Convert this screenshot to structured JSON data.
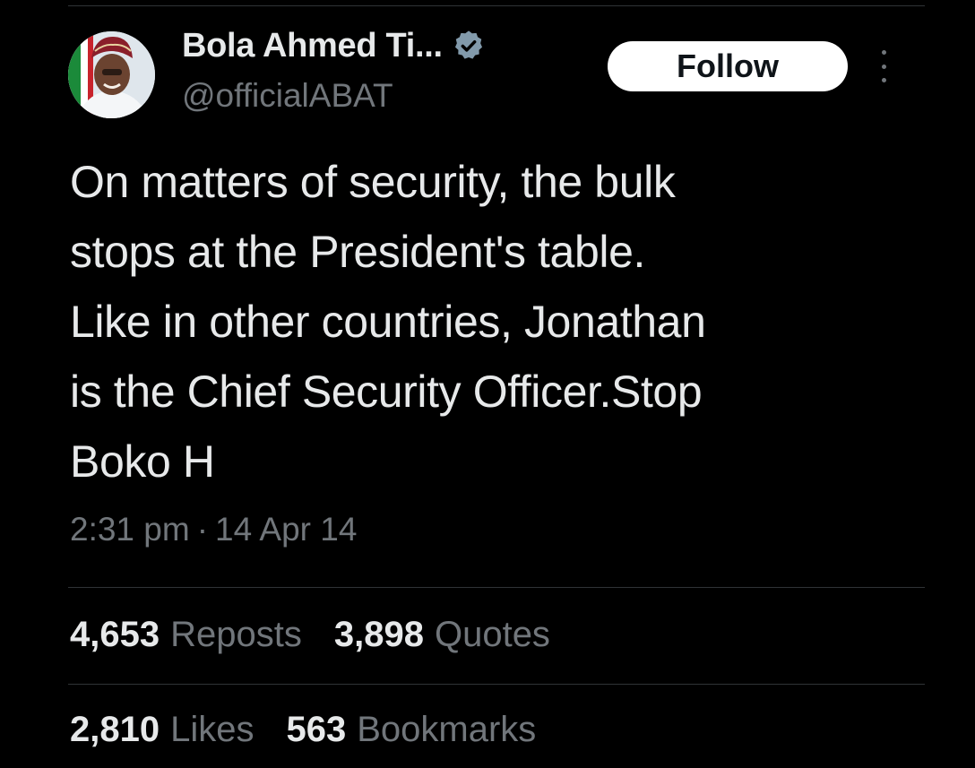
{
  "author": {
    "display_name": "Bola Ahmed Ti...",
    "handle": "@officialABAT",
    "verified_icon": "verified-badge-icon",
    "avatar": "avatar"
  },
  "actions": {
    "follow_label": "Follow",
    "more_icon": "more-vertical-icon"
  },
  "tweet": {
    "lines": [
      "On matters of security, the bulk",
      "stops at the President's table.",
      "Like in other countries, Jonathan",
      "is the Chief Security Officer.Stop",
      "Boko H"
    ],
    "time": "2:31 pm",
    "separator": "·",
    "date": "14 Apr 14"
  },
  "stats": {
    "row1": [
      {
        "count": "4,653",
        "label": "Reposts"
      },
      {
        "count": "3,898",
        "label": "Quotes"
      }
    ],
    "row2": [
      {
        "count": "2,810",
        "label": "Likes"
      },
      {
        "count": "563",
        "label": "Bookmarks"
      }
    ]
  },
  "colors": {
    "background": "#000000",
    "text_primary": "#e7e9ea",
    "text_secondary": "#71767b",
    "divider": "#2f3336",
    "verified_badge": "#829aab",
    "follow_bg": "#ffffff"
  }
}
